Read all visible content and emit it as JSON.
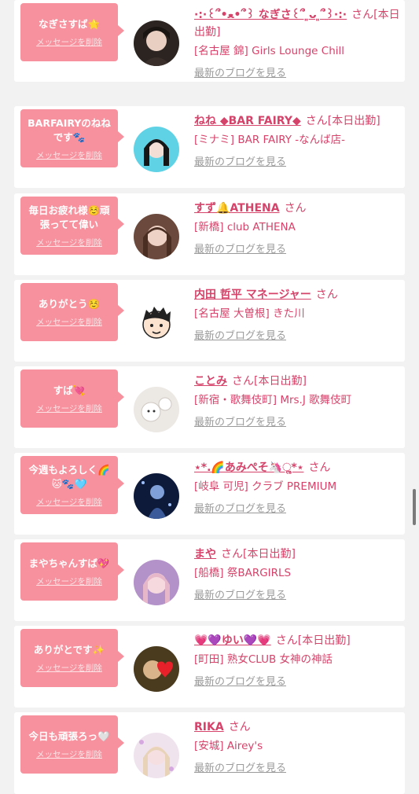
{
  "cards": [
    {
      "message": "なぎさすば🌟",
      "delete_label": "メッセージを削除",
      "name": "·:·꒰՞•ﻌ•՞꒱ なぎさ꒰՞ ͈ᴗ ͈՞꒱·:·",
      "suffix": "さん[本日出勤]",
      "shop": "[名古屋 錦] Girls Lounge Chill",
      "blog_label": "最新のブログを見る"
    },
    {
      "message": "BARFAIRYのねねです🐾",
      "delete_label": "メッセージを削除",
      "name": "ねね ◆BAR FAIRY◆",
      "suffix": "さん[本日出勤]",
      "shop": "[ミナミ] BAR FAIRY -なんば店-",
      "blog_label": "最新のブログを見る"
    },
    {
      "message": "毎日お疲れ様☺️頑張ってて偉い",
      "delete_label": "メッセージを削除",
      "name": "すず🔔ATHENA",
      "suffix": "さん",
      "shop": "[新橋] club ATHENA",
      "blog_label": "最新のブログを見る"
    },
    {
      "message": "ありがとう☺️",
      "delete_label": "メッセージを削除",
      "name": "内田 哲平 マネージャー",
      "suffix": "さん",
      "shop": "[名古屋 大曽根] きた川",
      "blog_label": "最新のブログを見る"
    },
    {
      "message": "すば💘",
      "delete_label": "メッセージを削除",
      "name": "ことみ",
      "suffix": "さん[本日出勤]",
      "shop": "[新宿・歌舞伎町] Mrs.J 歌舞伎町",
      "blog_label": "最新のブログを見る"
    },
    {
      "message": "今週もよろしく🌈🐱🐾🩵",
      "delete_label": "メッセージを削除",
      "name": "⋆*.🌈あみぺそ🦄ૢ*⋆",
      "suffix": "さん",
      "shop": "[岐阜 可児] クラブ PREMIUM",
      "blog_label": "最新のブログを見る"
    },
    {
      "message": "まやちゃんすば💖",
      "delete_label": "メッセージを削除",
      "name": "まや",
      "suffix": "さん[本日出勤]",
      "shop": "[船橋] 祭BARGIRLS",
      "blog_label": "最新のブログを見る"
    },
    {
      "message": "ありがとです✨",
      "delete_label": "メッセージを削除",
      "name": "💗💜ゆい💜💗",
      "suffix": "さん[本日出勤]",
      "shop": "[町田] 熟女CLUB 女神の神話",
      "blog_label": "最新のブログを見る"
    },
    {
      "message": "今日も頑張ろっ🤍",
      "delete_label": "メッセージを削除",
      "name": "RIKA",
      "suffix": "さん",
      "shop": "[安城] Airey's",
      "blog_label": "最新のブログを見る"
    }
  ],
  "colors": {
    "accent": "#d5436a",
    "bubble": "#f7919e",
    "link_gray": "#9a9a9a",
    "background": "#f2f2f2"
  }
}
